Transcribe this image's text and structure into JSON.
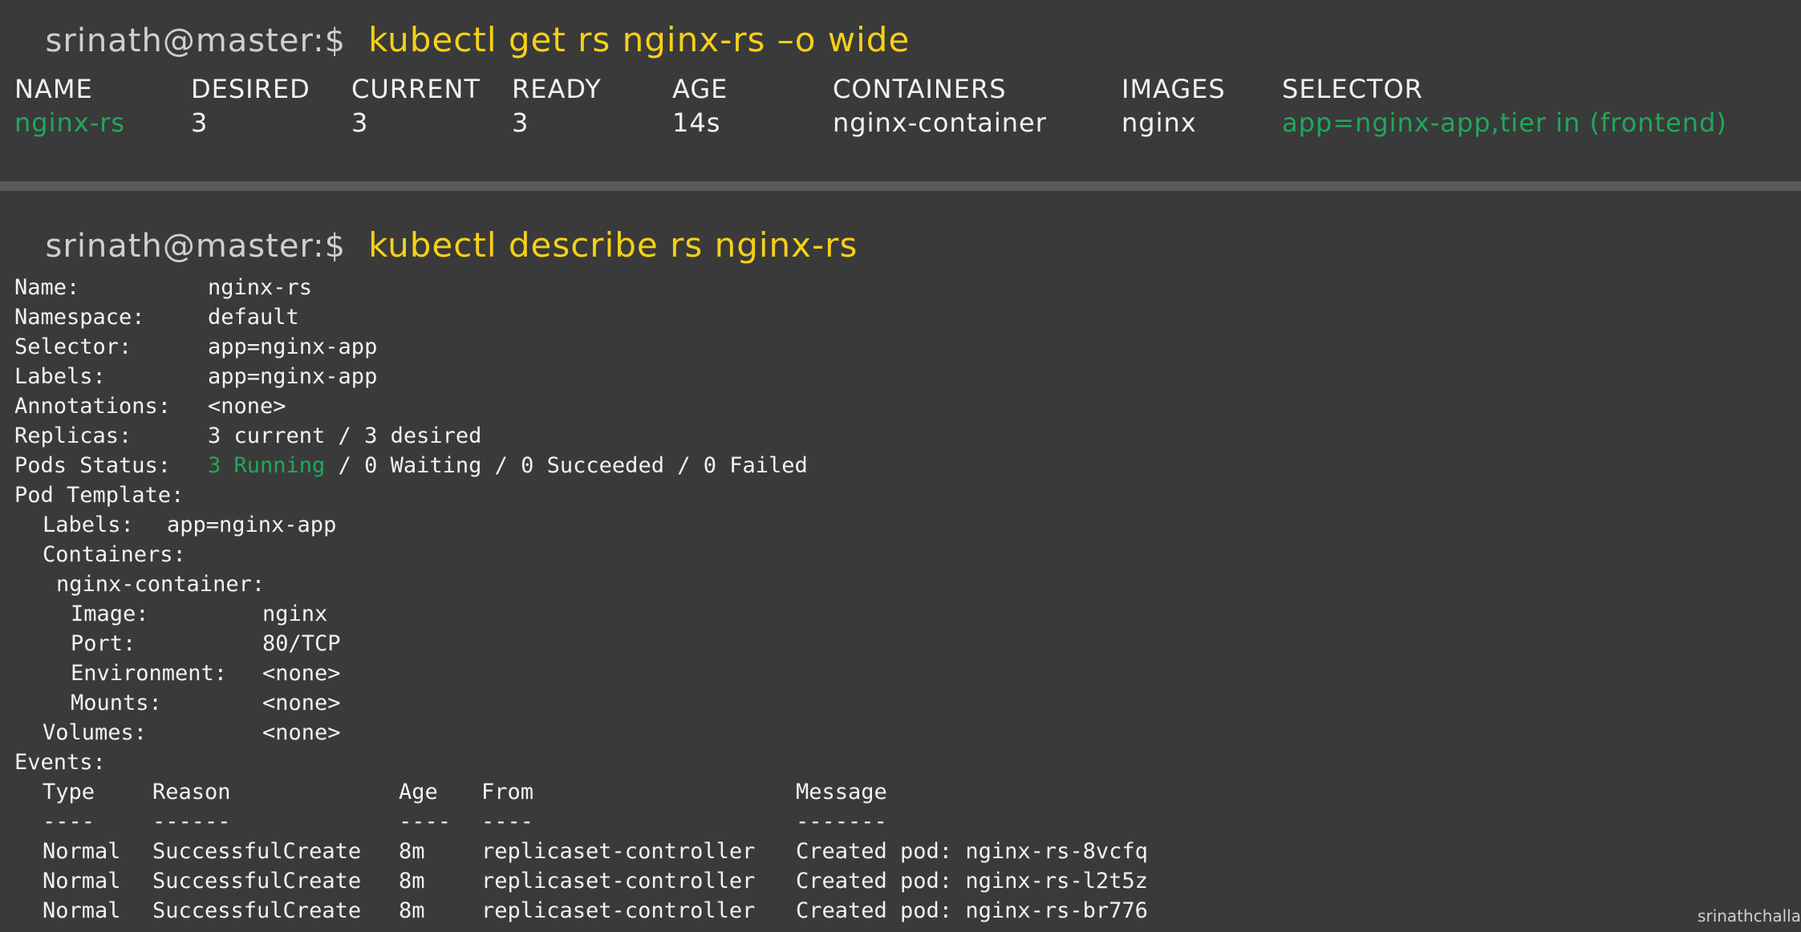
{
  "get_section": {
    "prompt": "srinath@master:$",
    "command": "kubectl get rs nginx-rs –o wide",
    "headers": [
      "NAME",
      "DESIRED",
      "CURRENT",
      "READY",
      "AGE",
      "CONTAINERS",
      "IMAGES",
      "SELECTOR"
    ],
    "row": [
      "nginx-rs",
      "3",
      "3",
      "3",
      "14s",
      "nginx-container",
      "nginx",
      "app=nginx-app,tier in (frontend)"
    ]
  },
  "describe_section": {
    "prompt": "srinath@master:$",
    "command": "kubectl describe rs nginx-rs",
    "fields": {
      "name_key": "Name:",
      "name_val": "nginx-rs",
      "namespace_key": "Namespace:",
      "namespace_val": "default",
      "selector_key": "Selector:",
      "selector_val": "app=nginx-app",
      "labels_key": "Labels:",
      "labels_val": "app=nginx-app",
      "annotations_key": "Annotations:",
      "annotations_val": "<none>",
      "replicas_key": "Replicas:",
      "replicas_val": "3 current / 3 desired",
      "pods_status_key": "Pods Status:",
      "pods_status_running": "3 Running",
      "pods_status_rest": " / 0 Waiting / 0 Succeeded / 0 Failed",
      "pod_template_key": "Pod Template:",
      "tmpl_labels_key": "Labels:",
      "tmpl_labels_val": "app=nginx-app",
      "containers_key": "Containers:",
      "container_name": "nginx-container:",
      "image_key": "Image:",
      "image_val": "nginx",
      "port_key": "Port:",
      "port_val": "80/TCP",
      "env_key": "Environment:",
      "env_val": "<none>",
      "mounts_key": "Mounts:",
      "mounts_val": "<none>",
      "volumes_key": "Volumes:",
      "volumes_val": "<none>",
      "events_key": "Events:"
    },
    "events": {
      "headers": [
        "Type",
        "Reason",
        "Age",
        "From",
        "Message"
      ],
      "dashes": [
        "----",
        "------",
        "----",
        "----",
        "-------"
      ],
      "rows": [
        [
          "Normal",
          "SuccessfulCreate",
          "8m",
          "replicaset-controller",
          "Created pod: nginx-rs-8vcfq"
        ],
        [
          "Normal",
          "SuccessfulCreate",
          "8m",
          "replicaset-controller",
          "Created pod: nginx-rs-l2t5z"
        ],
        [
          "Normal",
          "SuccessfulCreate",
          "8m",
          "replicaset-controller",
          "Created pod: nginx-rs-br776"
        ]
      ]
    }
  },
  "watermark": "srinathchalla",
  "colors": {
    "background": "#3a3a3a",
    "command": "#f6d018",
    "green": "#1fa85a",
    "divider": "#5a5a5a"
  }
}
